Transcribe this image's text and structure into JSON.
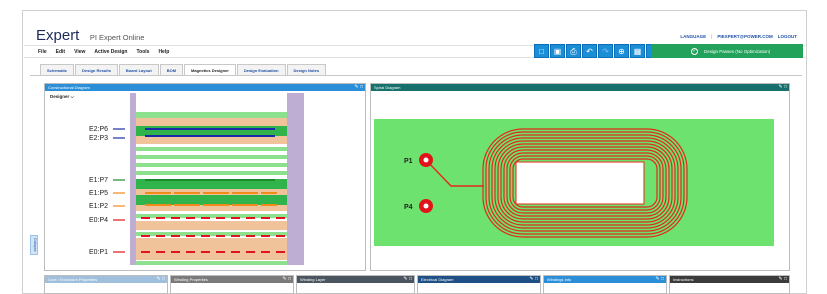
{
  "app": {
    "name": "Expert",
    "subtitle": "PI Expert Online"
  },
  "top_links": {
    "language": "LANGUAGE",
    "user": "PIEXPERT@POWER.COM",
    "logout": "LOGOUT"
  },
  "menu": [
    "File",
    "Edit",
    "View",
    "Active Design",
    "Tools",
    "Help"
  ],
  "toolbar_icons": [
    "new-file-icon",
    "open-folder-icon",
    "print-icon",
    "undo-icon",
    "redo-icon",
    "add-circle-icon",
    "library-icon",
    "help-icon"
  ],
  "status": {
    "text": "Design Passes (No Optimization)",
    "color": "#22a25a"
  },
  "tabs": [
    "Schematic",
    "Design Results",
    "Board Layout",
    "BOM",
    "Magnetics Designer",
    "Design Evaluation",
    "Design Notes"
  ],
  "active_tab": "Magnetics Designer",
  "panels": {
    "constructional": {
      "title": "Constructional Diagram",
      "view_select": "Designer",
      "winding_labels": [
        "E2:P6",
        "E2:P3",
        "E1:P7",
        "E1:P5",
        "E1:P2",
        "E0:P4",
        "E0:P1"
      ]
    },
    "spiral": {
      "title": "Spiral Diagram",
      "pins": [
        "P1",
        "P4"
      ]
    },
    "bottom": [
      "Core / Enclosure Properties",
      "Winding Properties",
      "Winding Layer",
      "Electrical Diagram",
      "Windings Info",
      "Instructions"
    ]
  },
  "side_handle": "Collapse"
}
